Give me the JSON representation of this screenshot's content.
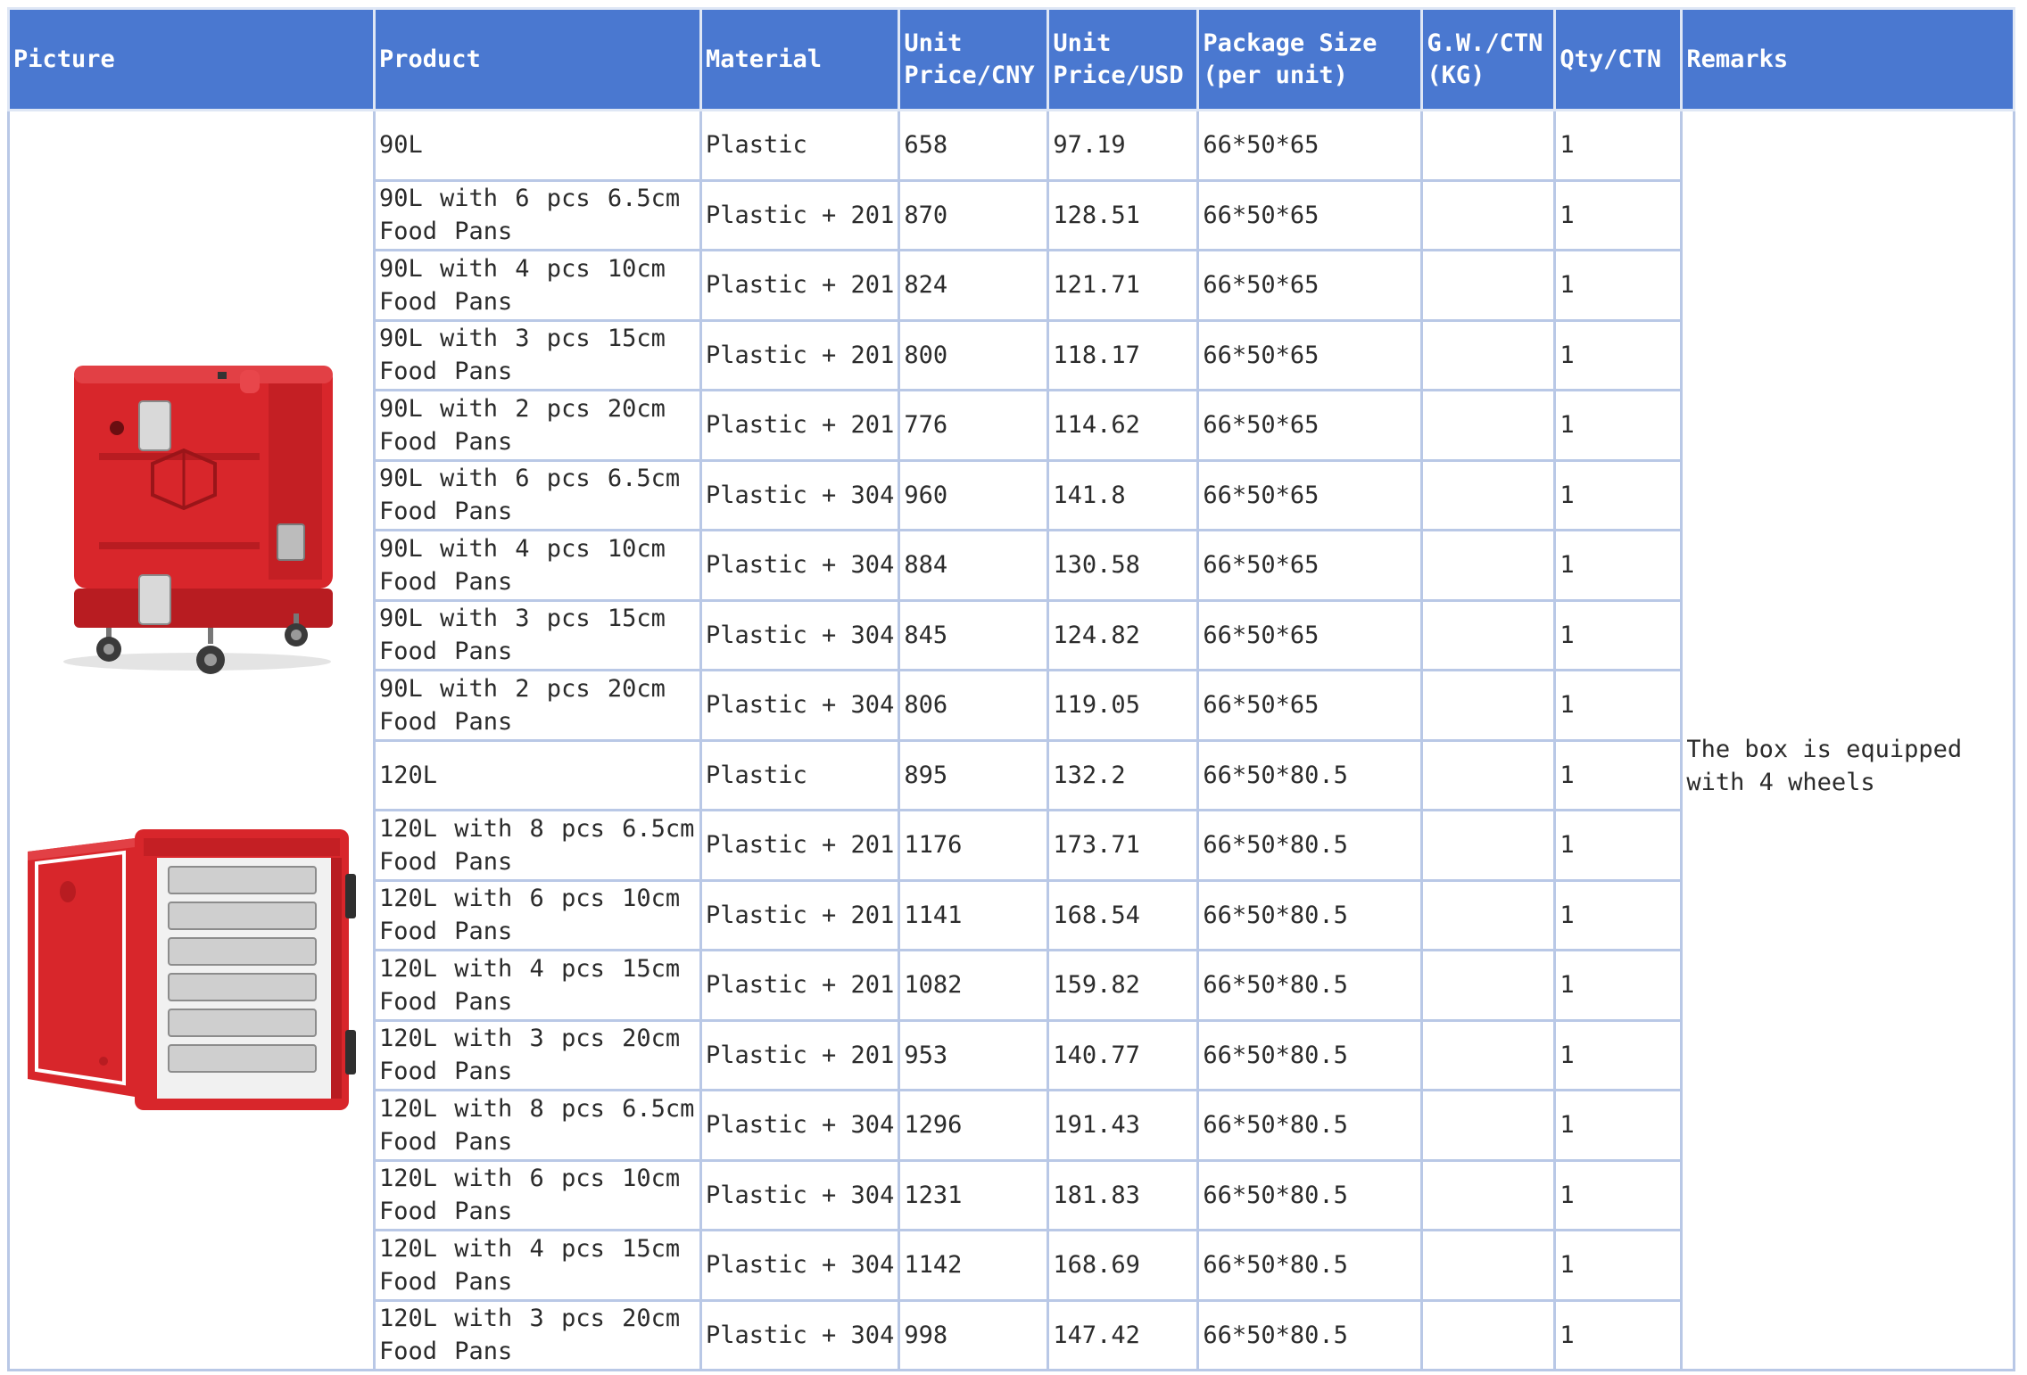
{
  "headers": [
    "Picture",
    "Product",
    "Material",
    "Unit\nPrice/CNY",
    "Unit\nPrice/USD",
    "Package Size\n(per unit)",
    "G.W./CTN\n(KG)",
    "Qty/CTN",
    "Remarks"
  ],
  "rows": [
    {
      "product": "90L",
      "material": "Plastic",
      "cny": "658",
      "usd": "97.19",
      "size": "66*50*65",
      "gw": "",
      "qty": "1"
    },
    {
      "product": "90L with 6 pcs 6.5cm Food Pans",
      "material": "Plastic + 201",
      "cny": "870",
      "usd": "128.51",
      "size": "66*50*65",
      "gw": "",
      "qty": "1"
    },
    {
      "product": "90L with 4 pcs 10cm Food Pans",
      "material": "Plastic + 201",
      "cny": "824",
      "usd": "121.71",
      "size": "66*50*65",
      "gw": "",
      "qty": "1"
    },
    {
      "product": "90L with 3 pcs 15cm Food Pans",
      "material": "Plastic + 201",
      "cny": "800",
      "usd": "118.17",
      "size": "66*50*65",
      "gw": "",
      "qty": "1"
    },
    {
      "product": "90L with 2 pcs 20cm Food Pans",
      "material": "Plastic + 201",
      "cny": "776",
      "usd": "114.62",
      "size": "66*50*65",
      "gw": "",
      "qty": "1"
    },
    {
      "product": "90L with 6 pcs 6.5cm Food Pans",
      "material": "Plastic + 304",
      "cny": "960",
      "usd": "141.8",
      "size": "66*50*65",
      "gw": "",
      "qty": "1"
    },
    {
      "product": "90L with 4 pcs 10cm Food Pans",
      "material": "Plastic + 304",
      "cny": "884",
      "usd": "130.58",
      "size": "66*50*65",
      "gw": "",
      "qty": "1"
    },
    {
      "product": "90L with 3 pcs 15cm Food Pans",
      "material": "Plastic + 304",
      "cny": "845",
      "usd": "124.82",
      "size": "66*50*65",
      "gw": "",
      "qty": "1"
    },
    {
      "product": "90L with 2 pcs 20cm Food Pans",
      "material": "Plastic + 304",
      "cny": "806",
      "usd": "119.05",
      "size": "66*50*65",
      "gw": "",
      "qty": "1"
    },
    {
      "product": "120L",
      "material": "Plastic",
      "cny": "895",
      "usd": "132.2",
      "size": "66*50*80.5",
      "gw": "",
      "qty": "1"
    },
    {
      "product": "120L with 8 pcs 6.5cm Food Pans",
      "material": "Plastic + 201",
      "cny": "1176",
      "usd": "173.71",
      "size": "66*50*80.5",
      "gw": "",
      "qty": "1"
    },
    {
      "product": "120L with 6 pcs 10cm Food Pans",
      "material": "Plastic + 201",
      "cny": "1141",
      "usd": "168.54",
      "size": "66*50*80.5",
      "gw": "",
      "qty": "1"
    },
    {
      "product": "120L with 4 pcs 15cm Food Pans",
      "material": "Plastic + 201",
      "cny": "1082",
      "usd": "159.82",
      "size": "66*50*80.5",
      "gw": "",
      "qty": "1"
    },
    {
      "product": "120L with 3 pcs 20cm Food Pans",
      "material": "Plastic + 201",
      "cny": "953",
      "usd": "140.77",
      "size": "66*50*80.5",
      "gw": "",
      "qty": "1"
    },
    {
      "product": "120L with 8 pcs 6.5cm Food Pans",
      "material": "Plastic + 304",
      "cny": "1296",
      "usd": "191.43",
      "size": "66*50*80.5",
      "gw": "",
      "qty": "1"
    },
    {
      "product": "120L with 6 pcs 10cm Food Pans",
      "material": "Plastic + 304",
      "cny": "1231",
      "usd": "181.83",
      "size": "66*50*80.5",
      "gw": "",
      "qty": "1"
    },
    {
      "product": "120L with 4 pcs 15cm Food Pans",
      "material": "Plastic + 304",
      "cny": "1142",
      "usd": "168.69",
      "size": "66*50*80.5",
      "gw": "",
      "qty": "1"
    },
    {
      "product": "120L with 3 pcs 20cm Food Pans",
      "material": "Plastic + 304",
      "cny": "998",
      "usd": "147.42",
      "size": "66*50*80.5",
      "gw": "",
      "qty": "1"
    }
  ],
  "remarks": "The box is equipped with 4 wheels",
  "colors": {
    "header_bg": "#4a78d0",
    "header_text": "#ffffff",
    "grid": "#b9c8e6",
    "product_red": "#d8262b"
  }
}
